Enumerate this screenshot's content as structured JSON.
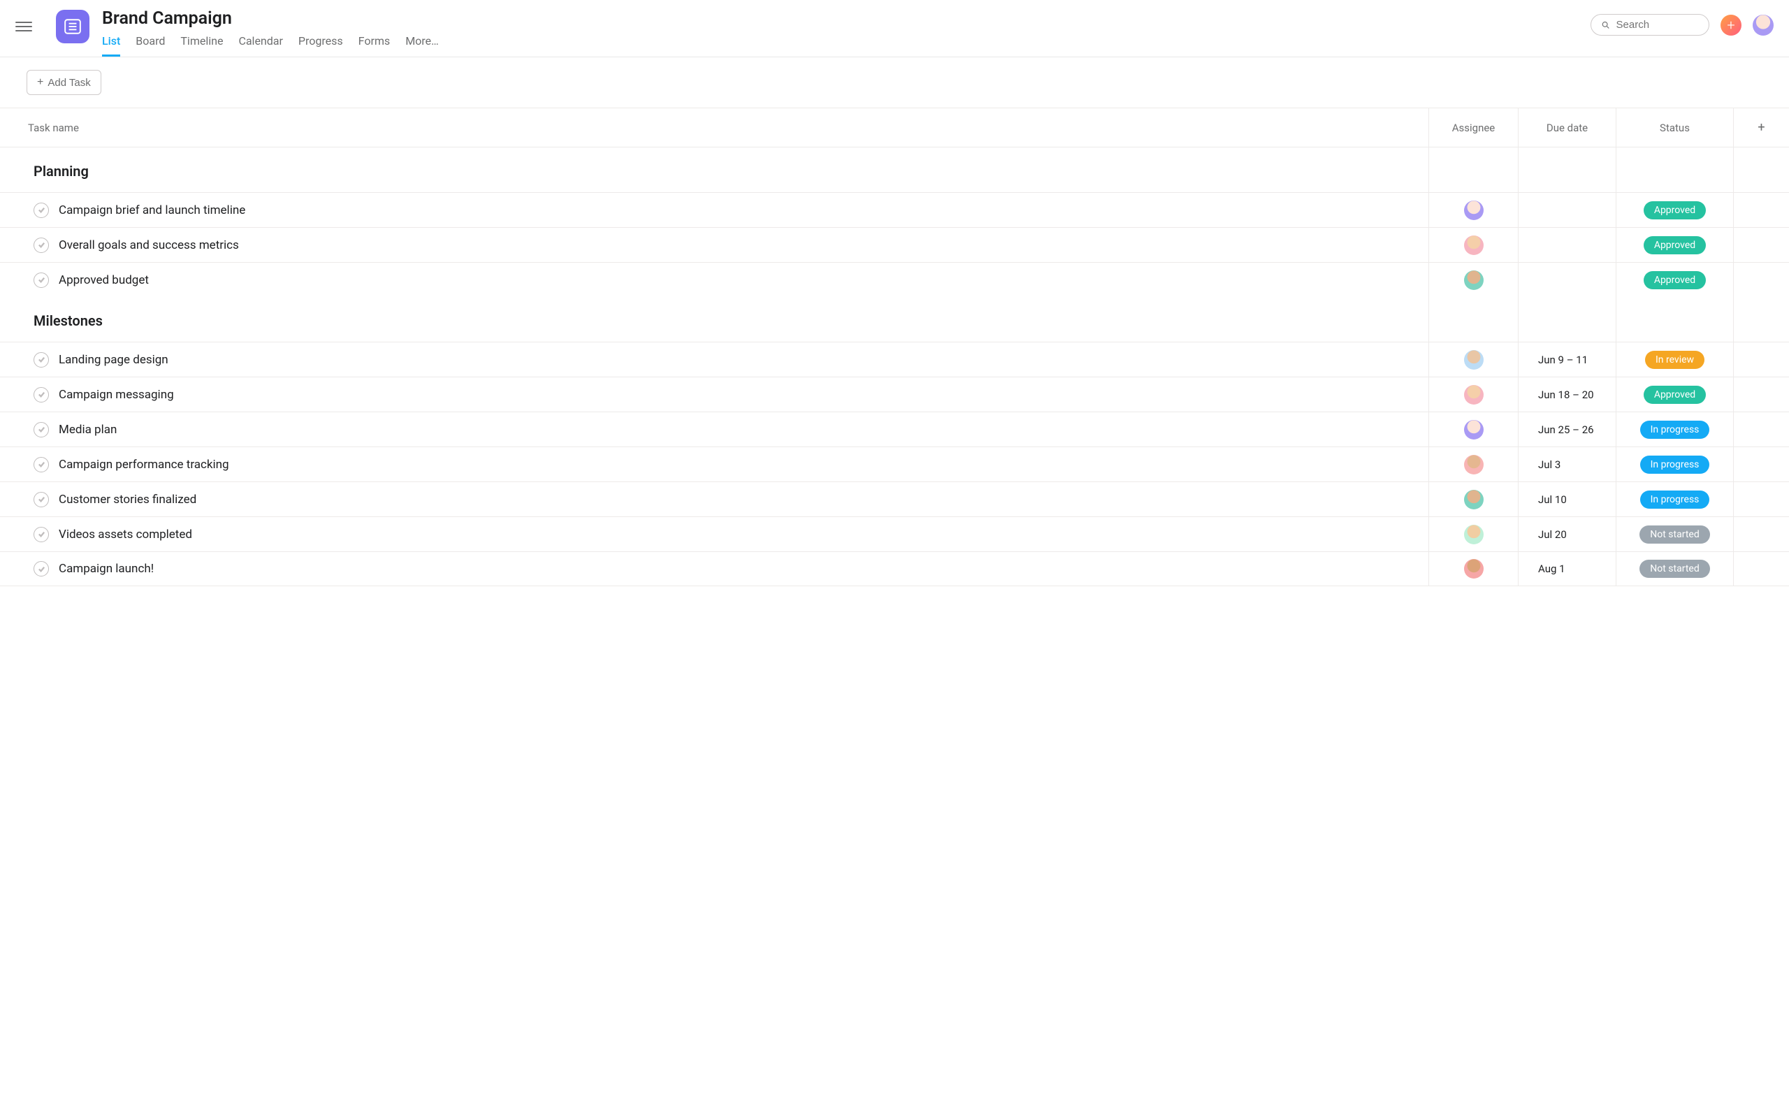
{
  "header": {
    "project_title": "Brand Campaign",
    "tabs": [
      "List",
      "Board",
      "Timeline",
      "Calendar",
      "Progress",
      "Forms",
      "More…"
    ],
    "active_tab_index": 0,
    "search_placeholder": "Search"
  },
  "toolbar": {
    "add_task_label": "Add Task"
  },
  "columns": {
    "task": "Task name",
    "assignee": "Assignee",
    "due": "Due date",
    "status": "Status"
  },
  "status_colors": {
    "Approved": "#25c2a0",
    "In review": "#f5a623",
    "In progress": "#14aaf5",
    "Not started": "#9ca6af"
  },
  "avatar_classes": {
    "a1": "av-purple",
    "a2": "av-pink",
    "a3": "av-teal",
    "a4": "av-blue",
    "a5": "av-rose",
    "a6": "av-mint",
    "a7": "av-salmon"
  },
  "user_avatar": "a1",
  "sections": [
    {
      "name": "Planning",
      "tasks": [
        {
          "name": "Campaign brief and launch timeline",
          "assignee": "a1",
          "due": "",
          "status": "Approved"
        },
        {
          "name": "Overall goals and success metrics",
          "assignee": "a2",
          "due": "",
          "status": "Approved"
        },
        {
          "name": "Approved budget",
          "assignee": "a3",
          "due": "",
          "status": "Approved"
        }
      ]
    },
    {
      "name": "Milestones",
      "tasks": [
        {
          "name": "Landing page design",
          "assignee": "a4",
          "due": "Jun 9 – 11",
          "status": "In review"
        },
        {
          "name": "Campaign messaging",
          "assignee": "a2",
          "due": "Jun 18 – 20",
          "status": "Approved"
        },
        {
          "name": "Media plan",
          "assignee": "a1",
          "due": "Jun 25 – 26",
          "status": "In progress"
        },
        {
          "name": "Campaign performance tracking",
          "assignee": "a5",
          "due": "Jul 3",
          "status": "In progress"
        },
        {
          "name": "Customer stories finalized",
          "assignee": "a3",
          "due": "Jul 10",
          "status": "In progress"
        },
        {
          "name": "Videos assets completed",
          "assignee": "a6",
          "due": "Jul 20",
          "status": "Not started"
        },
        {
          "name": "Campaign launch!",
          "assignee": "a7",
          "due": "Aug 1",
          "status": "Not started"
        }
      ]
    }
  ]
}
